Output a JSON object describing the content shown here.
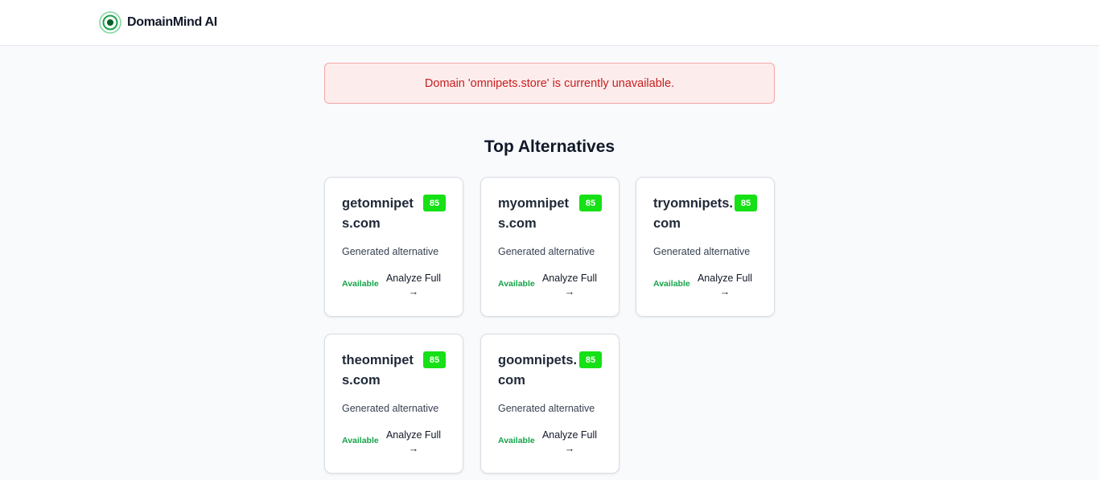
{
  "app": {
    "name": "DomainMind AI",
    "logo_icon": "radar-target-icon",
    "accent": "#16a34a"
  },
  "alert": {
    "message": "Domain 'omnipets.store' is currently unavailable.",
    "color": "#c81e1e",
    "background": "#fdecec"
  },
  "alternatives": {
    "title": "Top Alternatives",
    "items": [
      {
        "domain": "getomnipets.com",
        "score": "85",
        "description": "Generated alternative",
        "status": "Available",
        "action": "Analyze Full →"
      },
      {
        "domain": "myomnipets.com",
        "score": "85",
        "description": "Generated alternative",
        "status": "Available",
        "action": "Analyze Full →"
      },
      {
        "domain": "tryomnipets.com",
        "score": "85",
        "description": "Generated alternative",
        "status": "Available",
        "action": "Analyze Full →"
      },
      {
        "domain": "theomnipets.com",
        "score": "85",
        "description": "Generated alternative",
        "status": "Available",
        "action": "Analyze Full →"
      },
      {
        "domain": "goomnipets.com",
        "score": "85",
        "description": "Generated alternative",
        "status": "Available",
        "action": "Analyze Full →"
      }
    ]
  }
}
